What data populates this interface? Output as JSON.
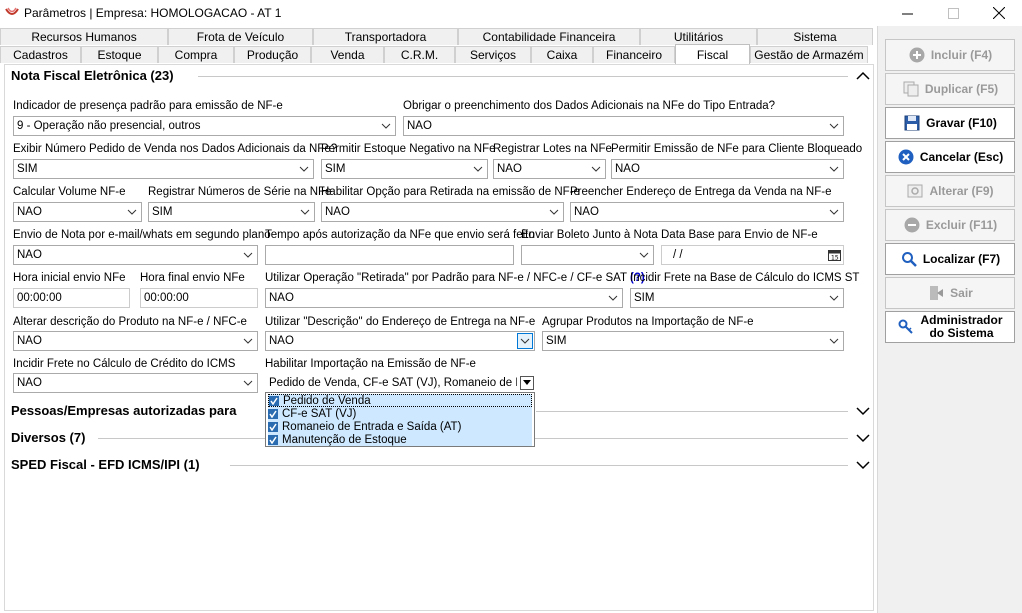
{
  "window": {
    "title": "Parâmetros | Empresa: HOMOLOGACAO - AT 1"
  },
  "tabs_top": [
    "Recursos Humanos",
    "Frota de Veículo",
    "Transportadora",
    "Contabilidade Financeira",
    "Utilitários",
    "Sistema"
  ],
  "tabs_bottom": [
    "Cadastros",
    "Estoque",
    "Compra",
    "Produção",
    "Venda",
    "C.R.M.",
    "Serviços",
    "Caixa",
    "Financeiro",
    "Fiscal",
    "Gestão de Armazém"
  ],
  "active_tab": "Fiscal",
  "sections": {
    "nfe": "Nota Fiscal Eletrônica (23)",
    "pessoas": "Pessoas/Empresas autorizadas para",
    "diversos": "Diversos (7)",
    "sped": "SPED Fiscal - EFD ICMS/IPI (1)"
  },
  "fields": {
    "f1": {
      "label": "Indicador de presença padrão para emissão de NF-e",
      "value": "9 - Operação não presencial, outros"
    },
    "f2": {
      "label": "Obrigar o preenchimento dos Dados Adicionais na NFe do Tipo Entrada?",
      "value": "NÃO"
    },
    "f3": {
      "label": "Exibir Número Pedido de Venda nos Dados Adicionais da NFe?",
      "value": "SIM"
    },
    "f4": {
      "label": "Permitir Estoque Negativo na NFe",
      "value": "SIM"
    },
    "f5": {
      "label": "Registrar Lotes na NFe",
      "value": "NÃO"
    },
    "f6": {
      "label": "Permitir Emissão de NFe para Cliente Bloqueado",
      "value": "NÃO"
    },
    "f7": {
      "label": "Calcular Volume NF-e",
      "value": "NÃO"
    },
    "f8": {
      "label": "Registrar Números de Série na NFe",
      "value": "SIM"
    },
    "f9": {
      "label": "Habilitar Opção para Retirada na emissão de NF-e",
      "value": "NÃO"
    },
    "f10": {
      "label": "Preencher Endereço de Entrega da Venda na NF-e",
      "value": "NÃO"
    },
    "f11": {
      "label": "Envio de Nota por e-mail/whats em segundo plano",
      "value": "NÃO"
    },
    "f12": {
      "label": "Tempo após autorização da NFe que envio será feito",
      "value": ""
    },
    "f13": {
      "label": "Enviar Boleto Junto à Nota",
      "value": ""
    },
    "f14": {
      "label": "Data Base para Envio de NF-e",
      "value": " /  /"
    },
    "f15": {
      "label": "Hora inicial envio NFe",
      "value": "00:00:00"
    },
    "f16": {
      "label": "Hora final envio NFe",
      "value": "00:00:00"
    },
    "f17": {
      "label": "Utilizar Operação \"Retirada\" por Padrão para NF-e / NFC-e / CF-e SAT",
      "help": "(?)",
      "value": "NÃO"
    },
    "f18": {
      "label": "Incidir Frete na Base de Cálculo do ICMS ST",
      "value": "SIM"
    },
    "f19": {
      "label": "Alterar descrição do Produto na NF-e / NFC-e",
      "value": "NÃO"
    },
    "f20": {
      "label": "Utilizar \"Descrição\" do Endereço de Entrega na NF-e",
      "value": "NÃO"
    },
    "f21": {
      "label": "Agrupar Produtos na Importação de NF-e",
      "value": "SIM"
    },
    "f22": {
      "label": "Incidir Frete no Cálculo de Crédito do ICMS",
      "value": "NÃO"
    },
    "f23": {
      "label": "Habilitar Importação na Emissão de NF-e",
      "value": "Pedido de Venda, CF-e SAT (VJ), Romaneio de Entr"
    }
  },
  "import_options": [
    "Pedido de Venda",
    "CF-e SAT (VJ)",
    "Romaneio de Entrada e Saída (AT)",
    "Manutenção de Estoque"
  ],
  "side_buttons": {
    "incluir": "Incluir (F4)",
    "duplicar": "Duplicar (F5)",
    "gravar": "Gravar (F10)",
    "cancelar": "Cancelar (Esc)",
    "alterar": "Alterar (F9)",
    "excluir": "Excluir (F11)",
    "localizar": "Localizar (F7)",
    "sair": "Sair",
    "admin_line1": "Administrador",
    "admin_line2": "do Sistema"
  },
  "colors": {
    "accent": "#0078d7",
    "check": "#2b6cb0",
    "cancel_icon": "#1f5fbf"
  }
}
